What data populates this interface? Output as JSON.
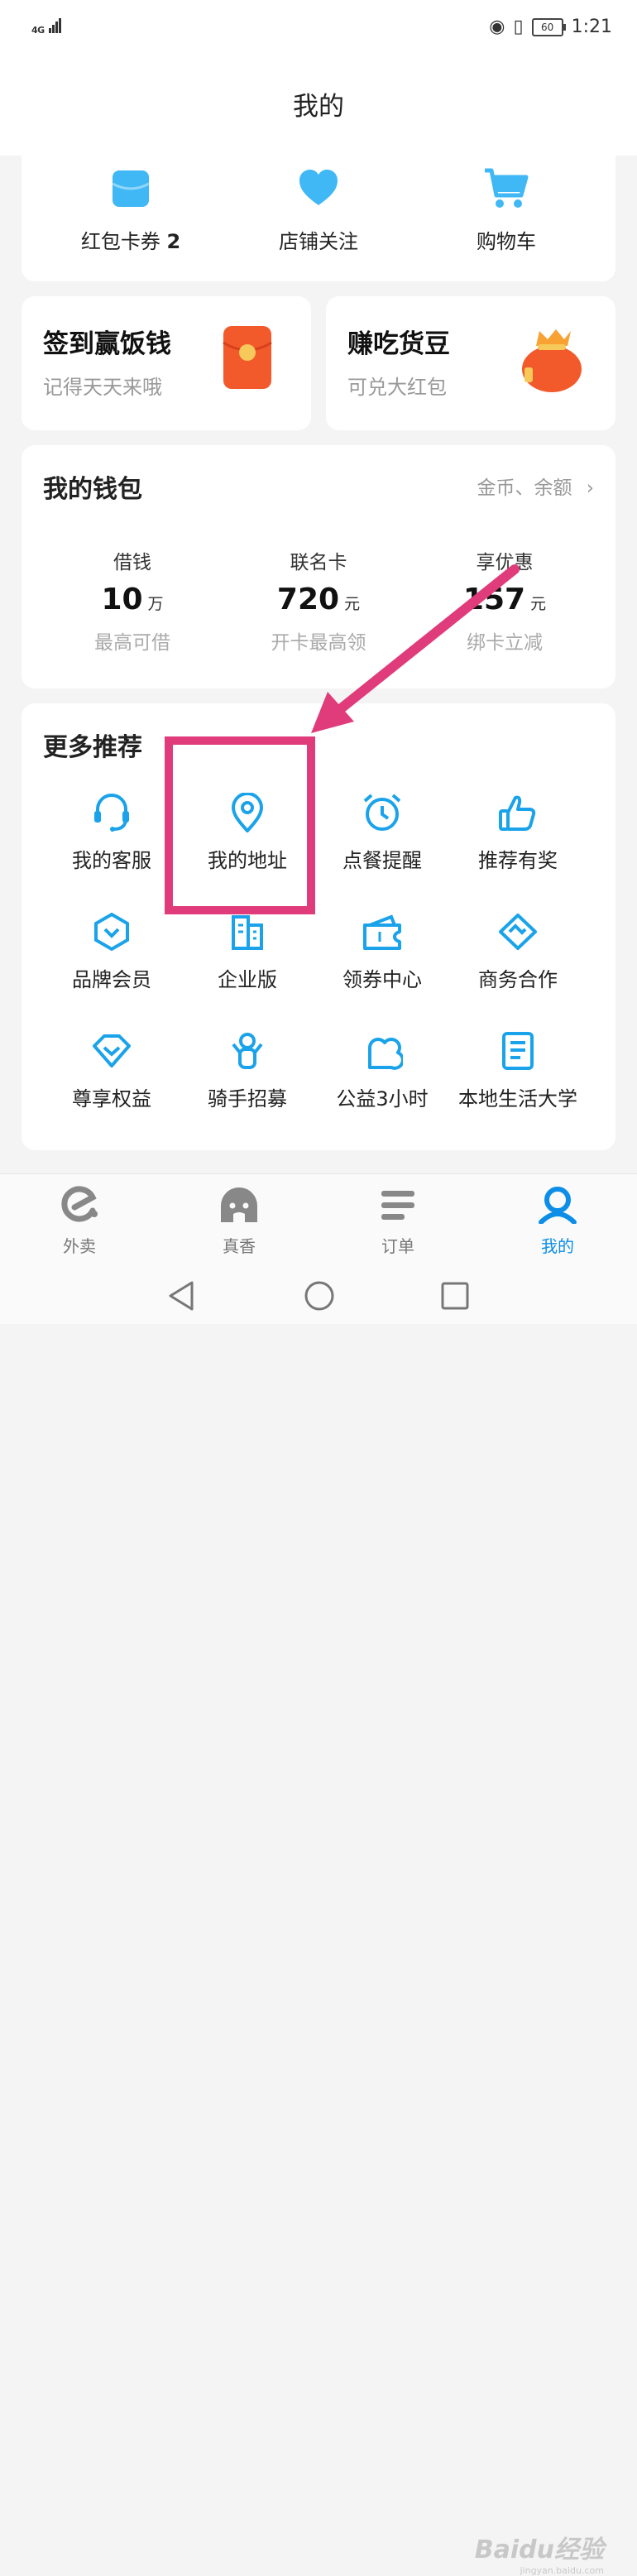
{
  "status_bar": {
    "network": "4G",
    "battery": "60",
    "time": "1:21"
  },
  "header": {
    "title": "我的"
  },
  "top_shortcuts": [
    {
      "label": "红包卡券",
      "count": "2",
      "icon": "wallet-icon"
    },
    {
      "label": "店铺关注",
      "icon": "heart-icon"
    },
    {
      "label": "购物车",
      "icon": "cart-icon"
    }
  ],
  "promos": [
    {
      "title": "签到赢饭钱",
      "subtitle": "记得天天来哦",
      "icon": "red-envelope-icon"
    },
    {
      "title": "赚吃货豆",
      "subtitle": "可兑大红包",
      "icon": "lucky-bag-icon"
    }
  ],
  "wallet": {
    "title": "我的钱包",
    "link": "金币、余额",
    "items": [
      {
        "label": "借钱",
        "value": "10",
        "unit": "万",
        "desc": "最高可借"
      },
      {
        "label": "联名卡",
        "value": "720",
        "unit": "元",
        "desc": "开卡最高领"
      },
      {
        "label": "享优惠",
        "value": "157",
        "unit": "元",
        "desc": "绑卡立减"
      }
    ]
  },
  "more": {
    "title": "更多推荐",
    "items": [
      {
        "label": "我的客服",
        "icon": "headset-icon"
      },
      {
        "label": "我的地址",
        "icon": "location-pin-icon"
      },
      {
        "label": "点餐提醒",
        "icon": "alarm-clock-icon"
      },
      {
        "label": "推荐有奖",
        "icon": "thumbs-up-icon"
      },
      {
        "label": "品牌会员",
        "icon": "brand-shield-icon"
      },
      {
        "label": "企业版",
        "icon": "building-icon"
      },
      {
        "label": "领券中心",
        "icon": "coupon-icon"
      },
      {
        "label": "商务合作",
        "icon": "handshake-icon"
      },
      {
        "label": "尊享权益",
        "icon": "diamond-icon"
      },
      {
        "label": "骑手招募",
        "icon": "rider-icon"
      },
      {
        "label": "公益3小时",
        "icon": "cloud-heart-icon"
      },
      {
        "label": "本地生活大学",
        "icon": "document-icon"
      }
    ]
  },
  "tabbar": [
    {
      "label": "外卖",
      "icon": "eleme-icon",
      "active": false
    },
    {
      "label": "真香",
      "icon": "ghost-icon",
      "active": false
    },
    {
      "label": "订单",
      "icon": "list-icon",
      "active": false
    },
    {
      "label": "我的",
      "icon": "user-icon",
      "active": true
    }
  ],
  "watermark": {
    "brand": "Baidu经验",
    "url": "jingyan.baidu.com"
  },
  "colors": {
    "accent": "#0c8ee8",
    "icon_blue": "#1aa3ea",
    "highlight": "#e03b7b",
    "promo_orange": "#f25a2c"
  }
}
